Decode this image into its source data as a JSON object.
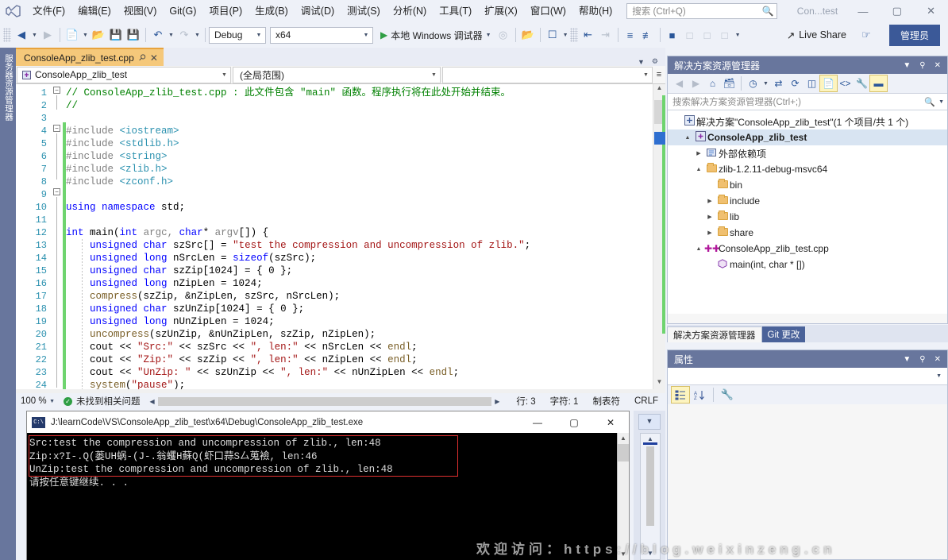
{
  "menu": {
    "items": [
      "文件(F)",
      "编辑(E)",
      "视图(V)",
      "Git(G)",
      "项目(P)",
      "生成(B)",
      "调试(D)",
      "测试(S)",
      "分析(N)",
      "工具(T)",
      "扩展(X)",
      "窗口(W)",
      "帮助(H)"
    ],
    "search_placeholder": "搜索 (Ctrl+Q)",
    "window_title": "Con...test",
    "minimize": "—",
    "maximize": "▢",
    "close": "✕"
  },
  "toolbar": {
    "config": "Debug",
    "platform": "x64",
    "run_label": "本地 Windows 调试器",
    "live_share": "Live Share",
    "admin": "管理员"
  },
  "left_dock": {
    "server_explorer": "服务器资源管理器"
  },
  "editor": {
    "tab_name": "ConsoleApp_zlib_test.cpp",
    "tab_pin": "⚲",
    "tab_close": "✕",
    "nav_scope_left": "ConsoleApp_zlib_test",
    "nav_scope_mid": "(全局范围)",
    "nav_scope_right": "",
    "lines": [
      {
        "n": "1",
        "frag": [
          {
            "t": "// ConsoleApp_zlib_test.cpp : 此文件包含 \"main\" 函数。程序执行将在此处开始并结束。",
            "c": "c"
          }
        ]
      },
      {
        "n": "2",
        "frag": [
          {
            "t": "//",
            "c": "c"
          }
        ]
      },
      {
        "n": "3",
        "frag": []
      },
      {
        "n": "4",
        "frag": [
          {
            "t": "#include ",
            "c": "pp"
          },
          {
            "t": "<iostream>",
            "c": "p"
          }
        ]
      },
      {
        "n": "5",
        "frag": [
          {
            "t": "#include ",
            "c": "pp"
          },
          {
            "t": "<stdlib.h>",
            "c": "p"
          }
        ]
      },
      {
        "n": "6",
        "frag": [
          {
            "t": "#include ",
            "c": "pp"
          },
          {
            "t": "<string>",
            "c": "p"
          }
        ]
      },
      {
        "n": "7",
        "frag": [
          {
            "t": "#include ",
            "c": "pp"
          },
          {
            "t": "<zlib.h>",
            "c": "p"
          }
        ]
      },
      {
        "n": "8",
        "frag": [
          {
            "t": "#include ",
            "c": "pp"
          },
          {
            "t": "<zconf.h>",
            "c": "p"
          }
        ]
      },
      {
        "n": "9",
        "frag": []
      },
      {
        "n": "10",
        "frag": [
          {
            "t": "using namespace ",
            "c": "k"
          },
          {
            "t": "std;",
            "c": "n"
          }
        ]
      },
      {
        "n": "11",
        "frag": []
      },
      {
        "n": "12",
        "frag": [
          {
            "t": "int ",
            "c": "k"
          },
          {
            "t": "main",
            "c": "n"
          },
          {
            "t": "(",
            "c": "n"
          },
          {
            "t": "int ",
            "c": "k"
          },
          {
            "t": "argc, ",
            "c": "pp"
          },
          {
            "t": "char",
            "c": "k"
          },
          {
            "t": "* ",
            "c": "n"
          },
          {
            "t": "argv",
            "c": "pp"
          },
          {
            "t": "[]) {",
            "c": "n"
          }
        ]
      },
      {
        "n": "13",
        "frag": [
          {
            "t": "    ",
            "c": "n"
          },
          {
            "t": "unsigned char ",
            "c": "k"
          },
          {
            "t": "szSrc[] = ",
            "c": "n"
          },
          {
            "t": "\"test the compression and uncompression of zlib.\"",
            "c": "s"
          },
          {
            "t": ";",
            "c": "n"
          }
        ]
      },
      {
        "n": "14",
        "frag": [
          {
            "t": "    ",
            "c": "n"
          },
          {
            "t": "unsigned long ",
            "c": "k"
          },
          {
            "t": "nSrcLen = ",
            "c": "n"
          },
          {
            "t": "sizeof",
            "c": "k"
          },
          {
            "t": "(szSrc);",
            "c": "n"
          }
        ]
      },
      {
        "n": "15",
        "frag": [
          {
            "t": "    ",
            "c": "n"
          },
          {
            "t": "unsigned char ",
            "c": "k"
          },
          {
            "t": "szZip[1024] = { 0 };",
            "c": "n"
          }
        ]
      },
      {
        "n": "16",
        "frag": [
          {
            "t": "    ",
            "c": "n"
          },
          {
            "t": "unsigned long ",
            "c": "k"
          },
          {
            "t": "nZipLen = 1024;",
            "c": "n"
          }
        ]
      },
      {
        "n": "17",
        "frag": [
          {
            "t": "    ",
            "c": "n"
          },
          {
            "t": "compress",
            "c": "fn"
          },
          {
            "t": "(szZip, &nZipLen, szSrc, nSrcLen);",
            "c": "n"
          }
        ]
      },
      {
        "n": "18",
        "frag": [
          {
            "t": "    ",
            "c": "n"
          },
          {
            "t": "unsigned char ",
            "c": "k"
          },
          {
            "t": "szUnZip[1024] = { 0 };",
            "c": "n"
          }
        ]
      },
      {
        "n": "19",
        "frag": [
          {
            "t": "    ",
            "c": "n"
          },
          {
            "t": "unsigned long ",
            "c": "k"
          },
          {
            "t": "nUnZipLen = 1024;",
            "c": "n"
          }
        ]
      },
      {
        "n": "20",
        "frag": [
          {
            "t": "    ",
            "c": "n"
          },
          {
            "t": "uncompress",
            "c": "fn"
          },
          {
            "t": "(szUnZip, &nUnZipLen, szZip, nZipLen);",
            "c": "n"
          }
        ]
      },
      {
        "n": "21",
        "frag": [
          {
            "t": "    cout << ",
            "c": "n"
          },
          {
            "t": "\"Src:\"",
            "c": "s"
          },
          {
            "t": " << szSrc << ",
            "c": "n"
          },
          {
            "t": "\", len:\"",
            "c": "s"
          },
          {
            "t": " << nSrcLen << ",
            "c": "n"
          },
          {
            "t": "endl",
            "c": "fn"
          },
          {
            "t": ";",
            "c": "n"
          }
        ]
      },
      {
        "n": "22",
        "frag": [
          {
            "t": "    cout << ",
            "c": "n"
          },
          {
            "t": "\"Zip:\"",
            "c": "s"
          },
          {
            "t": " << szZip << ",
            "c": "n"
          },
          {
            "t": "\", len:\"",
            "c": "s"
          },
          {
            "t": " << nZipLen << ",
            "c": "n"
          },
          {
            "t": "endl",
            "c": "fn"
          },
          {
            "t": ";",
            "c": "n"
          }
        ]
      },
      {
        "n": "23",
        "frag": [
          {
            "t": "    cout << ",
            "c": "n"
          },
          {
            "t": "\"UnZip: \"",
            "c": "s"
          },
          {
            "t": " << szUnZip << ",
            "c": "n"
          },
          {
            "t": "\", len:\"",
            "c": "s"
          },
          {
            "t": " << nUnZipLen << ",
            "c": "n"
          },
          {
            "t": "endl",
            "c": "fn"
          },
          {
            "t": ";",
            "c": "n"
          }
        ]
      },
      {
        "n": "24",
        "frag": [
          {
            "t": "    ",
            "c": "n"
          },
          {
            "t": "system",
            "c": "fn"
          },
          {
            "t": "(",
            "c": "n"
          },
          {
            "t": "\"pause\"",
            "c": "s"
          },
          {
            "t": ");",
            "c": "n"
          }
        ]
      }
    ]
  },
  "status": {
    "zoom": "100 %",
    "problems": "未找到相关问题",
    "line": "行: 3",
    "col": "字符: 1",
    "tabs": "制表符",
    "eol": "CRLF"
  },
  "solution_explorer": {
    "title": "解决方案资源管理器",
    "search_placeholder": "搜索解决方案资源管理器(Ctrl+;)",
    "tree": [
      {
        "indent": 0,
        "arrow": "",
        "icon": "solution",
        "label": "解决方案\"ConsoleApp_zlib_test\"(1 个项目/共 1 个)",
        "bold": false,
        "sel": false
      },
      {
        "indent": 1,
        "arrow": "▲",
        "icon": "project",
        "label": "ConsoleApp_zlib_test",
        "bold": true,
        "sel": true
      },
      {
        "indent": 2,
        "arrow": "▶",
        "icon": "refs",
        "label": "外部依赖项",
        "bold": false,
        "sel": false
      },
      {
        "indent": 2,
        "arrow": "▲",
        "icon": "folder",
        "label": "zlib-1.2.11-debug-msvc64",
        "bold": false,
        "sel": false
      },
      {
        "indent": 3,
        "arrow": "",
        "icon": "folder",
        "label": "bin",
        "bold": false,
        "sel": false
      },
      {
        "indent": 3,
        "arrow": "▶",
        "icon": "folder",
        "label": "include",
        "bold": false,
        "sel": false
      },
      {
        "indent": 3,
        "arrow": "▶",
        "icon": "folder",
        "label": "lib",
        "bold": false,
        "sel": false
      },
      {
        "indent": 3,
        "arrow": "▶",
        "icon": "folder",
        "label": "share",
        "bold": false,
        "sel": false
      },
      {
        "indent": 2,
        "arrow": "▲",
        "icon": "cpp",
        "label": "ConsoleApp_zlib_test.cpp",
        "bold": false,
        "sel": false
      },
      {
        "indent": 3,
        "arrow": "",
        "icon": "method",
        "label": "main(int, char * [])",
        "bold": false,
        "sel": false
      }
    ],
    "tabs": [
      {
        "label": "解决方案资源管理器",
        "active": true
      },
      {
        "label": "Git 更改",
        "active": false
      }
    ]
  },
  "properties": {
    "title": "属性"
  },
  "console": {
    "title": "J:\\learnCode\\VS\\ConsoleApp_zlib_test\\x64\\Debug\\ConsoleApp_zlib_test.exe",
    "minimize": "—",
    "maximize": "▢",
    "close": "✕",
    "lines": [
      "Src:test the compression and uncompression of zlib., len:48",
      "Zip:x?I-.Q(蒌UH蜗-(J-.翁蠼H蘇Q(虾口蒜S厶蒐襝, len:46",
      "UnZip:test the compression and uncompression of zlib., len:48",
      "请按任意键继续. . ."
    ]
  },
  "watermark": {
    "text": "欢迎访问：https://blog.weixinzeng.cn"
  }
}
